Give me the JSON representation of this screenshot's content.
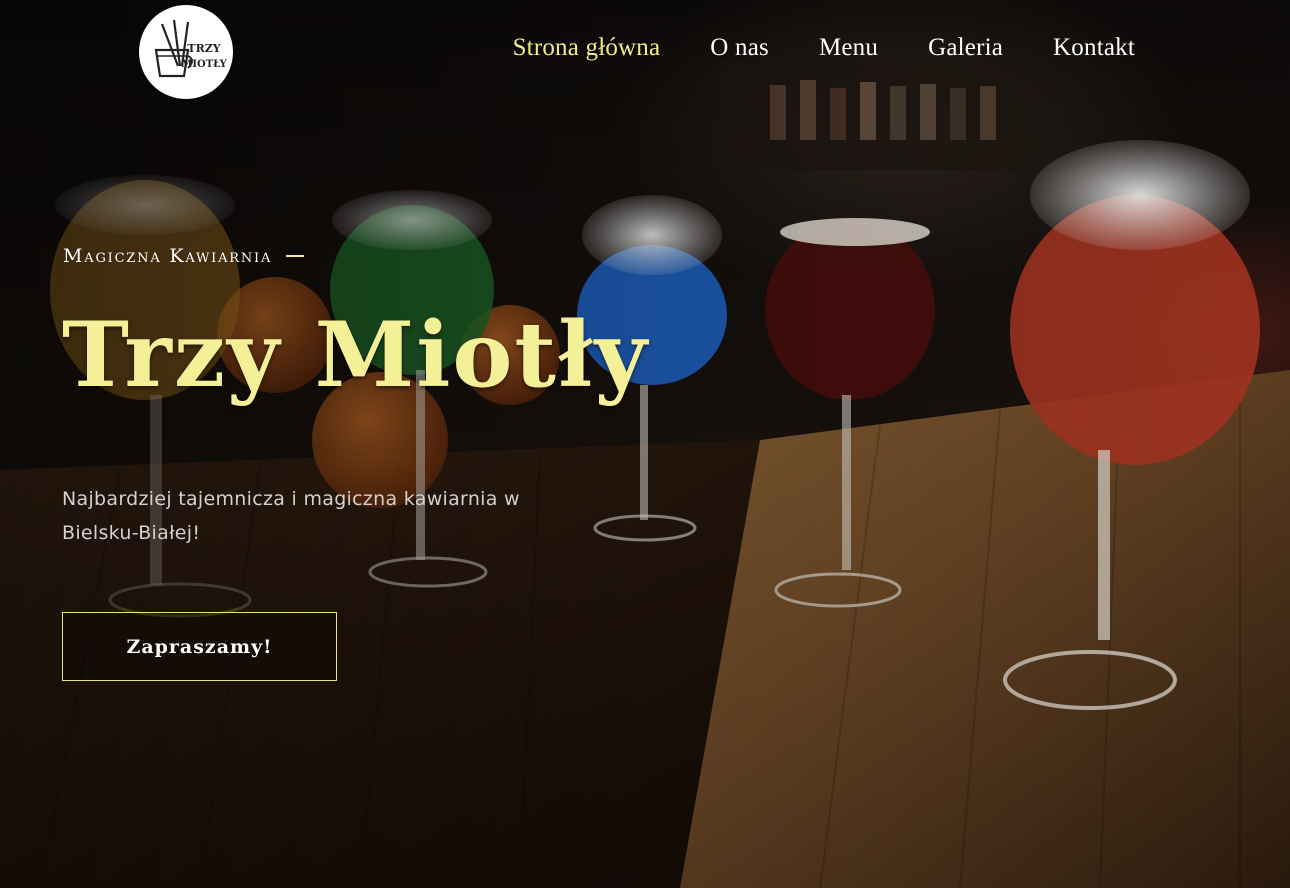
{
  "header": {
    "logo": {
      "icon": "broom-cup-logo",
      "text_line1": "TRZY",
      "text_line2": "MIOTŁY"
    },
    "nav": [
      {
        "label": "Strona główna",
        "active": true
      },
      {
        "label": "O nas",
        "active": false
      },
      {
        "label": "Menu",
        "active": false
      },
      {
        "label": "Galeria",
        "active": false
      },
      {
        "label": "Kontakt",
        "active": false
      }
    ]
  },
  "hero": {
    "eyebrow": "Magiczna Kawiarnia",
    "title": "Trzy Miotły",
    "subtitle": "Najbardziej tajemnicza i magiczna kawiarnia w Bielsku-Białej!",
    "cta_label": "Zapraszamy!"
  },
  "colors": {
    "accent": "#f2ec86",
    "title": "#f4f098",
    "text": "#ffffff",
    "background": "#0b0908"
  }
}
